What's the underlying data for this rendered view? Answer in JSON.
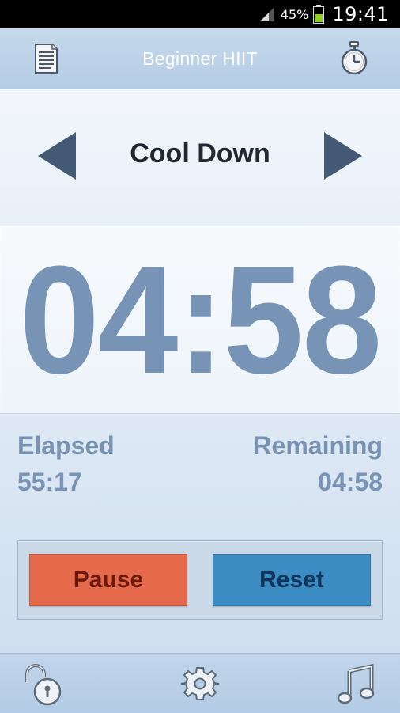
{
  "status_bar": {
    "battery_percent": "45%",
    "time": "19:41",
    "battery_level": 0.45,
    "icons": [
      "signal-icon",
      "battery-icon"
    ]
  },
  "title_bar": {
    "title": "Beginner HIIT",
    "left_icon": "document-list-icon",
    "right_icon": "stopwatch-icon"
  },
  "interval": {
    "name": "Cool Down",
    "prev_icon": "arrow-left-icon",
    "next_icon": "arrow-right-icon"
  },
  "timer": {
    "display": "04:58"
  },
  "stats": {
    "elapsed_label": "Elapsed",
    "elapsed_value": "55:17",
    "remaining_label": "Remaining",
    "remaining_value": "04:58"
  },
  "controls": {
    "pause_label": "Pause",
    "reset_label": "Reset"
  },
  "bottom_bar": {
    "icons": [
      "unlock-icon",
      "gear-icon",
      "music-note-icon"
    ]
  },
  "colors": {
    "timer_text": "#7793b5",
    "pause_button": "#e5694b",
    "reset_button": "#3b8cc2",
    "title_bar": "#b4cce5"
  }
}
